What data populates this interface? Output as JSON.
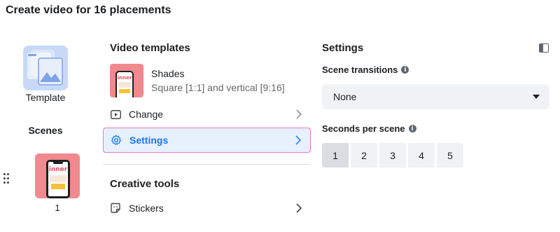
{
  "page": {
    "title": "Create video for 16 placements"
  },
  "left_rail": {
    "template_label": "Template",
    "scenes_label": "Scenes",
    "scene_number": "1",
    "thumb_text": "inner"
  },
  "templates": {
    "title": "Video templates",
    "current": {
      "name": "Shades",
      "description": "Square [1:1] and vertical [9:16]",
      "thumb_text": "inner"
    },
    "menu": [
      {
        "label": "Change",
        "icon": "play-icon"
      },
      {
        "label": "Settings",
        "icon": "gear-icon",
        "active": true
      }
    ]
  },
  "creative_tools": {
    "title": "Creative tools",
    "items": [
      {
        "label": "Stickers",
        "icon": "sticker-icon"
      }
    ]
  },
  "settings": {
    "title": "Settings",
    "scene_transitions": {
      "label": "Scene transitions",
      "value": "None"
    },
    "seconds_per_scene": {
      "label": "Seconds per scene",
      "options": [
        "1",
        "2",
        "3",
        "4",
        "5"
      ],
      "selected": "1"
    }
  },
  "colors": {
    "accent": "#1877f2",
    "active_border": "#e67ac7",
    "thumb_bg": "#f08a8e",
    "template_tile": "#c8d9f7"
  }
}
